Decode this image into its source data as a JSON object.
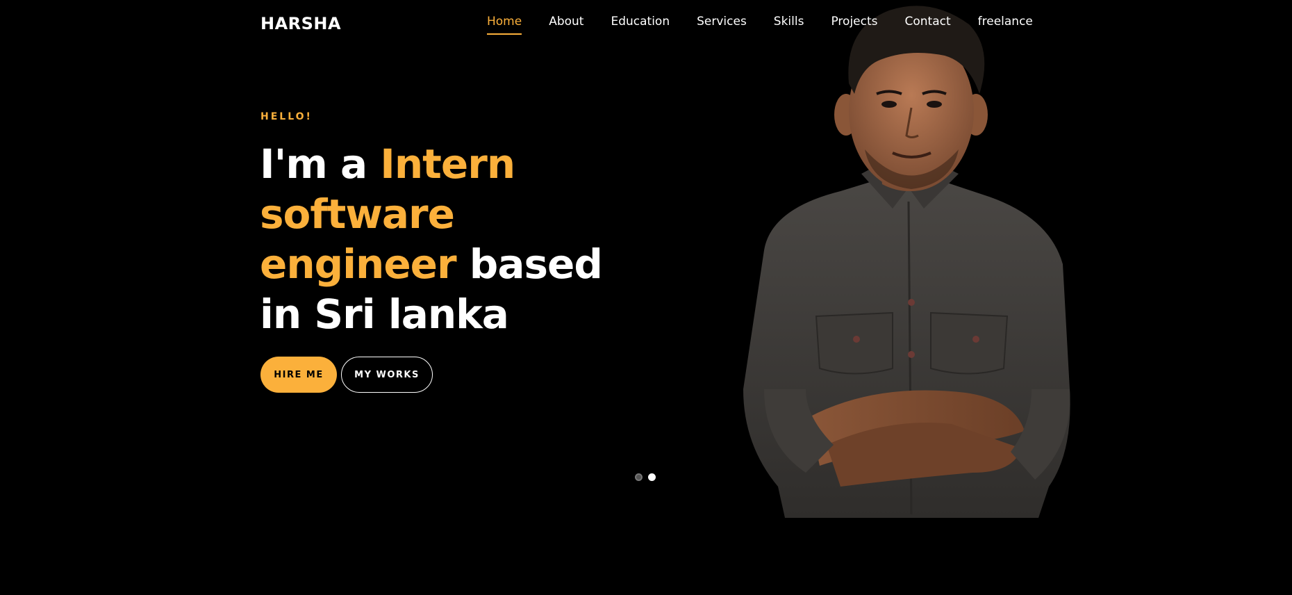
{
  "brand": "HARSHA",
  "nav": {
    "items": [
      {
        "label": "Home",
        "active": true
      },
      {
        "label": "About"
      },
      {
        "label": "Education"
      },
      {
        "label": "Services"
      },
      {
        "label": "Skills"
      },
      {
        "label": "Projects"
      },
      {
        "label": "Contact"
      },
      {
        "label": "freelance"
      }
    ]
  },
  "hero": {
    "eyebrow": "HELLO!",
    "headline": {
      "part1": "I'm a ",
      "accent1": "Intern software engineer",
      "part2": " based in Sri lanka"
    },
    "buttons": {
      "hire": "HIRE ME",
      "works": "MY WORKS"
    }
  },
  "carousel": {
    "slides": 2,
    "active_index": 1
  },
  "colors": {
    "accent": "#fbb03b",
    "background": "#000000",
    "text": "#ffffff"
  },
  "icons": {
    "portrait": "person-portrait"
  }
}
